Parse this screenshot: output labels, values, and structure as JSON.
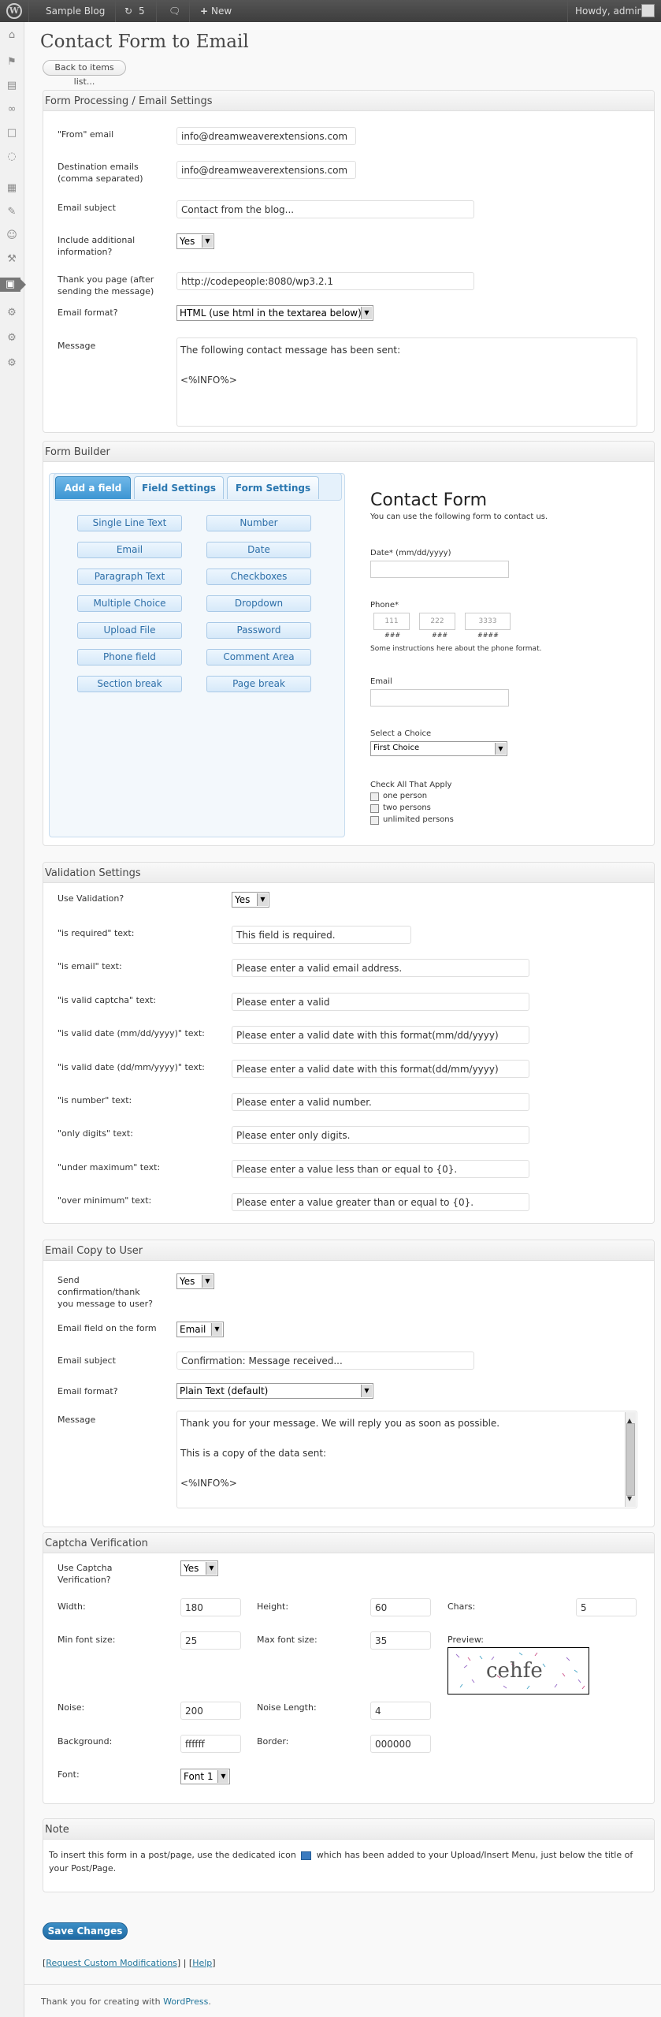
{
  "adminbar": {
    "site": "Sample Blog",
    "updates": "5",
    "new": "New",
    "howdy": "Howdy, admin"
  },
  "page": {
    "title": "Contact Form to Email",
    "back": "Back to items list..."
  },
  "processing": {
    "heading": "Form Processing / Email Settings",
    "from_label": "\"From\" email",
    "from_value": "info@dreamweaverextensions.com",
    "dest_label": "Destination emails (comma separated)",
    "dest_value": "info@dreamweaverextensions.com",
    "subject_label": "Email subject",
    "subject_value": "Contact from the blog...",
    "include_label": "Include additional information?",
    "include_value": "Yes",
    "thanks_label": "Thank you page (after sending the message)",
    "thanks_value": "http://codepeople:8080/wp3.2.1",
    "format_label": "Email format?",
    "format_value": "HTML (use html in the textarea below)",
    "message_label": "Message",
    "message_line1": "The following contact message has been sent:",
    "message_line2": "<%INFO%>"
  },
  "builder": {
    "heading": "Form Builder",
    "tabs": [
      "Add a field",
      "Field Settings",
      "Form Settings"
    ],
    "fields": [
      "Single Line Text",
      "Number",
      "Email",
      "Date",
      "Paragraph Text",
      "Checkboxes",
      "Multiple Choice",
      "Dropdown",
      "Upload File",
      "Password",
      "Phone field",
      "Comment Area",
      "Section break",
      "Page break"
    ],
    "preview": {
      "title": "Contact Form",
      "subtitle": "You can use the following form to contact us.",
      "date_label": "Date* (mm/dd/yyyy)",
      "phone_label": "Phone*",
      "phone_ph1": "111",
      "phone_ph2": "222",
      "phone_ph3": "3333",
      "phone_h1": "###",
      "phone_h2": "###",
      "phone_h3": "####",
      "phone_help": "Some instructions here about the phone format.",
      "email_label": "Email",
      "choice_label": "Select a Choice",
      "choice_value": "First Choice",
      "checks_label": "Check All That Apply",
      "checks": [
        "one person",
        "two persons",
        "unlimited persons"
      ]
    }
  },
  "validation": {
    "heading": "Validation Settings",
    "use_label": "Use Validation?",
    "use_value": "Yes",
    "rows": [
      {
        "label": "\"is required\" text:",
        "value": "This field is required."
      },
      {
        "label": "\"is email\" text:",
        "value": "Please enter a valid email address."
      },
      {
        "label": "\"is valid captcha\" text:",
        "value": "Please enter a valid"
      },
      {
        "label": "\"is valid date (mm/dd/yyyy)\" text:",
        "value": "Please enter a valid date with this format(mm/dd/yyyy)"
      },
      {
        "label": "\"is valid date (dd/mm/yyyy)\" text:",
        "value": "Please enter a valid date with this format(dd/mm/yyyy)"
      },
      {
        "label": "\"is number\" text:",
        "value": "Please enter a valid number."
      },
      {
        "label": "\"only digits\" text:",
        "value": "Please enter only digits."
      },
      {
        "label": "\"under maximum\" text:",
        "value": "Please enter a value less than or equal to {0}."
      },
      {
        "label": "\"over minimum\" text:",
        "value": "Please enter a value greater than or equal to {0}."
      }
    ]
  },
  "copy": {
    "heading": "Email Copy to User",
    "send_label": "Send confirmation/thank you message to user?",
    "send_value": "Yes",
    "field_label": "Email field on the form",
    "field_value": "Email",
    "subject_label": "Email subject",
    "subject_value": "Confirmation: Message received...",
    "format_label": "Email format?",
    "format_value": "Plain Text (default)",
    "message_label": "Message",
    "message_line1": "Thank you for your message. We will reply you as soon as possible.",
    "message_line2": "This is a copy of the data sent:",
    "message_line3": "<%INFO%>"
  },
  "captcha": {
    "heading": "Captcha Verification",
    "use_label": "Use Captcha Verification?",
    "use_value": "Yes",
    "width_label": "Width:",
    "width_value": "180",
    "height_label": "Height:",
    "height_value": "60",
    "chars_label": "Chars:",
    "chars_value": "5",
    "minfont_label": "Min font size:",
    "minfont_value": "25",
    "maxfont_label": "Max font size:",
    "maxfont_value": "35",
    "preview_label": "Preview:",
    "preview_text": "cehfe",
    "noise_label": "Noise:",
    "noise_value": "200",
    "noiselen_label": "Noise Length:",
    "noiselen_value": "4",
    "bg_label": "Background:",
    "bg_value": "ffffff",
    "border_label": "Border:",
    "border_value": "000000",
    "font_label": "Font:",
    "font_value": "Font 1"
  },
  "note": {
    "heading": "Note",
    "text1": "To insert this form in a post/page, use the dedicated icon",
    "text2": "which has been added to your Upload/Insert Menu, just below the title of your Post/Page."
  },
  "save": "Save Changes",
  "links": {
    "request": "Request Custom Modifications",
    "help": "Help",
    "open": "[",
    "mid": "] | [",
    "close": "]"
  },
  "footer": {
    "text": "Thank you for creating with",
    "link": "WordPress",
    "end": "."
  }
}
